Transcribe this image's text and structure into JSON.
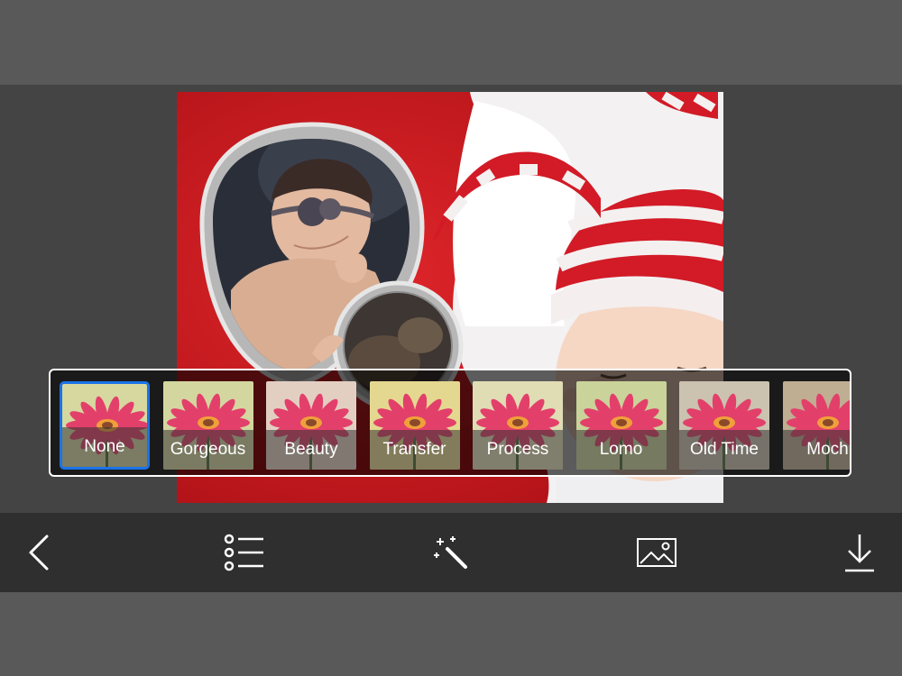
{
  "filters": [
    {
      "label": "None",
      "selected": true,
      "tint": "#d6d8a0"
    },
    {
      "label": "Gorgeous",
      "selected": false,
      "tint": "#d4d6a0"
    },
    {
      "label": "Beauty",
      "selected": false,
      "tint": "#e2cfc2"
    },
    {
      "label": "Transfer",
      "selected": false,
      "tint": "#e4d890"
    },
    {
      "label": "Process",
      "selected": false,
      "tint": "#e0dcb4"
    },
    {
      "label": "Lomo",
      "selected": false,
      "tint": "#c9d39a"
    },
    {
      "label": "Old Time",
      "selected": false,
      "tint": "#cbc2b0"
    },
    {
      "label": "Moch",
      "selected": false,
      "tint": "#bfae92"
    }
  ],
  "toolbar": {
    "items": [
      {
        "name": "back-button",
        "icon": "chevron-left-icon"
      },
      {
        "name": "list-button",
        "icon": "list-icon"
      },
      {
        "name": "magic-wand-button",
        "icon": "magic-wand-icon"
      },
      {
        "name": "photo-button",
        "icon": "image-icon"
      },
      {
        "name": "download-button",
        "icon": "download-icon"
      }
    ]
  },
  "colors": {
    "selection": "#1a73e8",
    "background_red": "#c8151b",
    "toolbar": "#2f2f2f"
  }
}
